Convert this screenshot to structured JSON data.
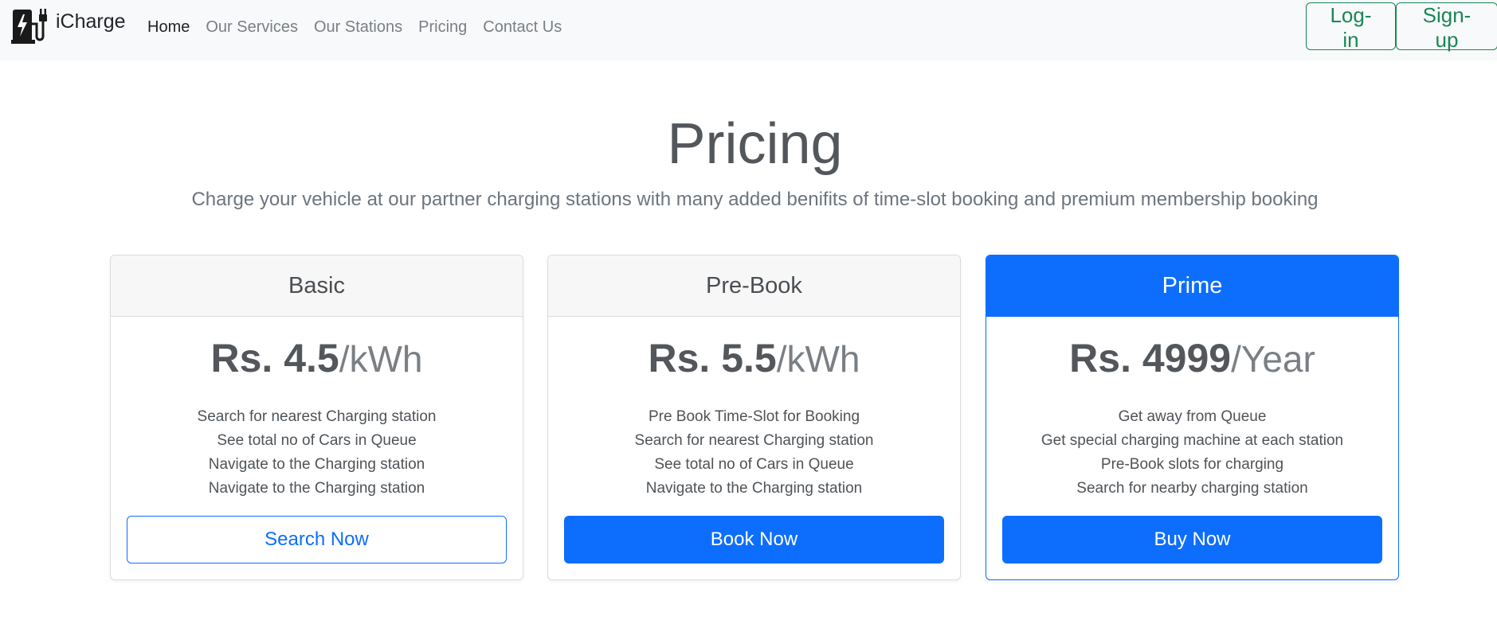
{
  "brand": {
    "name": "iCharge",
    "logo_icon": "ev-charger-icon"
  },
  "nav": {
    "items": [
      {
        "label": "Home",
        "active": true
      },
      {
        "label": "Our Services",
        "active": false
      },
      {
        "label": "Our Stations",
        "active": false
      },
      {
        "label": "Pricing",
        "active": false
      },
      {
        "label": "Contact Us",
        "active": false
      }
    ]
  },
  "auth": {
    "login_label": "Log-in",
    "signup_label": "Sign-up"
  },
  "hero": {
    "title": "Pricing",
    "subtitle": "Charge your vehicle at our partner charging stations with many added benifits of time-slot booking and premium membership booking"
  },
  "plans": [
    {
      "name": "Basic",
      "price": "Rs. 4.5",
      "unit": "/kWh",
      "features": [
        "Search for nearest Charging station",
        "See total no of Cars in Queue",
        "Navigate to the Charging station",
        "Navigate to the Charging station"
      ],
      "button_label": "Search Now"
    },
    {
      "name": "Pre-Book",
      "price": "Rs. 5.5",
      "unit": "/kWh",
      "features": [
        "Pre Book Time-Slot for Booking",
        "Search for nearest Charging station",
        "See total no of Cars in Queue",
        "Navigate to the Charging station"
      ],
      "button_label": "Book Now"
    },
    {
      "name": "Prime",
      "price": "Rs. 4999",
      "unit": "/Year",
      "features": [
        "Get away from Queue",
        "Get special charging machine at each station",
        "Pre-Book slots for charging",
        "Search for nearby charging station"
      ],
      "button_label": "Buy Now"
    }
  ],
  "colors": {
    "primary": "#0d6efd",
    "success": "#198754",
    "navbar_bg": "#f8f9fa",
    "muted_text": "#6c757d"
  }
}
